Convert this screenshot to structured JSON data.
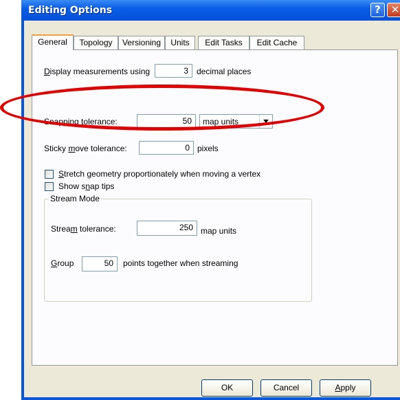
{
  "window": {
    "title": "Editing Options",
    "help": "?",
    "close": "✕"
  },
  "tabs": [
    "General",
    "Topology",
    "Versioning",
    "Units",
    "Edit Tasks",
    "Edit Cache"
  ],
  "general": {
    "display": {
      "prefix_u": "D",
      "prefix_rest": "isplay measurements using",
      "value": "3",
      "suffix": "decimal places"
    },
    "snapping": {
      "label_a": "Snapping ",
      "label_u": "t",
      "label_b": "olerance:",
      "value": "50",
      "unit": "map units"
    },
    "sticky": {
      "label_a": "Sticky ",
      "label_u": "m",
      "label_b": "ove tolerance:",
      "value": "0",
      "unit": "pixels"
    },
    "stretch": {
      "u": "S",
      "rest": "tretch geometry proportionately when moving a vertex",
      "checked": false
    },
    "snap_tips": {
      "a": "Show s",
      "u": "n",
      "b": "ap tips",
      "checked": false
    },
    "stream": {
      "legend": "Stream Mode",
      "tol_a": "Strea",
      "tol_u": "m",
      "tol_b": " tolerance:",
      "tol_value": "250",
      "tol_unit": "map units",
      "group_u": "G",
      "group_rest": "roup",
      "group_value": "50",
      "group_suffix": "points together when streaming"
    }
  },
  "buttons": {
    "ok": "OK",
    "cancel": "Cancel",
    "apply_u": "A",
    "apply_rest": "pply"
  },
  "colors": {
    "highlight": "#e00000",
    "titlebar": "#0550d8"
  }
}
